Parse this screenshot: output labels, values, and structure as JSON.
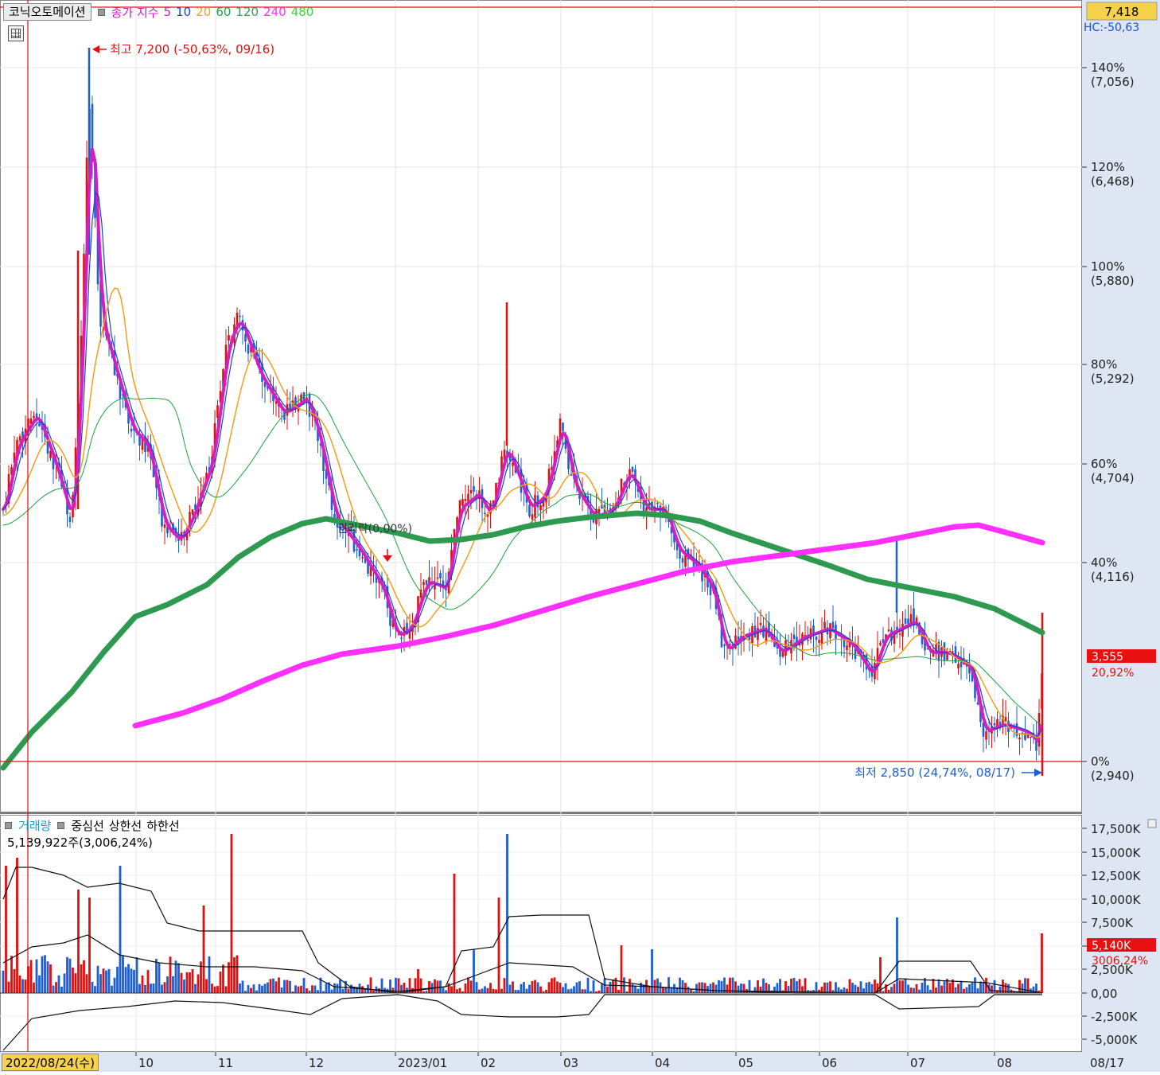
{
  "header": {
    "symbol": "코닉오토메이션",
    "ma_title": "종가 지수",
    "ma_periods": [
      {
        "label": "5",
        "color": "#e020c0"
      },
      {
        "label": "10",
        "color": "#2040d0"
      },
      {
        "label": "20",
        "color": "#f0a020"
      },
      {
        "label": "60",
        "color": "#20a040"
      },
      {
        "label": "120",
        "color": "#30a050"
      },
      {
        "label": "240",
        "color": "#ff30ff"
      },
      {
        "label": "480",
        "color": "#40d040"
      }
    ]
  },
  "price_panel": {
    "current_price_tag": "7,418",
    "hc_label": "HC:-50,63",
    "high_annotation": "최고 7,200 (-50,63%, 09/16)",
    "low_annotation": "최저 2,850 (24,74%, 08/17)",
    "ex_rights_label": "권리락(0,00%)",
    "last_price_tag": "3,555",
    "last_pct_tag": "20,92%",
    "y_axis": [
      {
        "pct": "140%",
        "price": "(7,056)"
      },
      {
        "pct": "120%",
        "price": "(6,468)"
      },
      {
        "pct": "100%",
        "price": "(5,880)"
      },
      {
        "pct": "80%",
        "price": "(5,292)"
      },
      {
        "pct": "60%",
        "price": "(4,704)"
      },
      {
        "pct": "40%",
        "price": "(4,116)"
      },
      {
        "pct": "0%",
        "price": "(2,940)"
      }
    ]
  },
  "volume_panel": {
    "legend": {
      "volume": "거래량",
      "center": "중심선",
      "upper": "상한선",
      "lower": "하한선"
    },
    "summary": "5,139,922주(3,006,24%)",
    "last_volume_tag": "5,140K",
    "last_volume_pct": "3006,24%",
    "y_axis": [
      "17,500K",
      "15,000K",
      "12,500K",
      "10,000K",
      "7,500K",
      "5,000K",
      "2,500K",
      "0,00",
      "-2,500K",
      "-5,000K"
    ]
  },
  "x_axis": {
    "first_date": "2022/08/24(수)",
    "months": [
      "10",
      "11",
      "12",
      "2023/01",
      "02",
      "03",
      "04",
      "05",
      "06",
      "07",
      "08"
    ],
    "right_date": "08/17"
  },
  "colors": {
    "up": "#e01010",
    "down": "#1f5fd0",
    "ma5": "#d020c0",
    "ma60": "#2e9a50",
    "ma240": "#ff30ff",
    "ma20": "#f0a020",
    "axis_bg": "#dde6f2",
    "tag_red": "#e81010",
    "tag_yellow": "#f6d24a"
  }
}
